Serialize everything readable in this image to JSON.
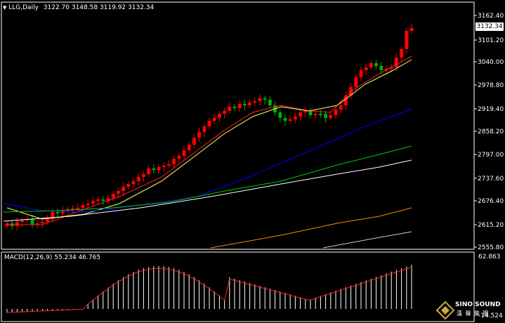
{
  "main_panel": {
    "symbol": "LLG,Daily",
    "ohlc": "3122.70 3148.58 3119.92 3132.34",
    "current_price": "3132.34",
    "price_ticks": [
      "3162.40",
      "3101.20",
      "3040.00",
      "2978.80",
      "2919.40",
      "2858.20",
      "2797.00",
      "2737.60",
      "2676.40",
      "2615.20",
      "2555.80"
    ]
  },
  "macd_panel": {
    "label": "MACD(12,26,9) 55.234 46.765",
    "top_value": "62.863",
    "bottom_value": "-14.524"
  },
  "watermark": {
    "brand": "SINO SOUND",
    "brand_cn": "漢 聲 集 團"
  },
  "colors": {
    "background": "#000000",
    "bull": "#ff0000",
    "bear": "#00aa00",
    "ma_fast": "#ff2222",
    "ma_mid": "#ffff66",
    "ma_blue": "#0000ff",
    "ma_green": "#00cc00",
    "ma_white": "#ffffff",
    "ma_orange": "#ff8800",
    "macd_signal": "#ff2222"
  }
}
